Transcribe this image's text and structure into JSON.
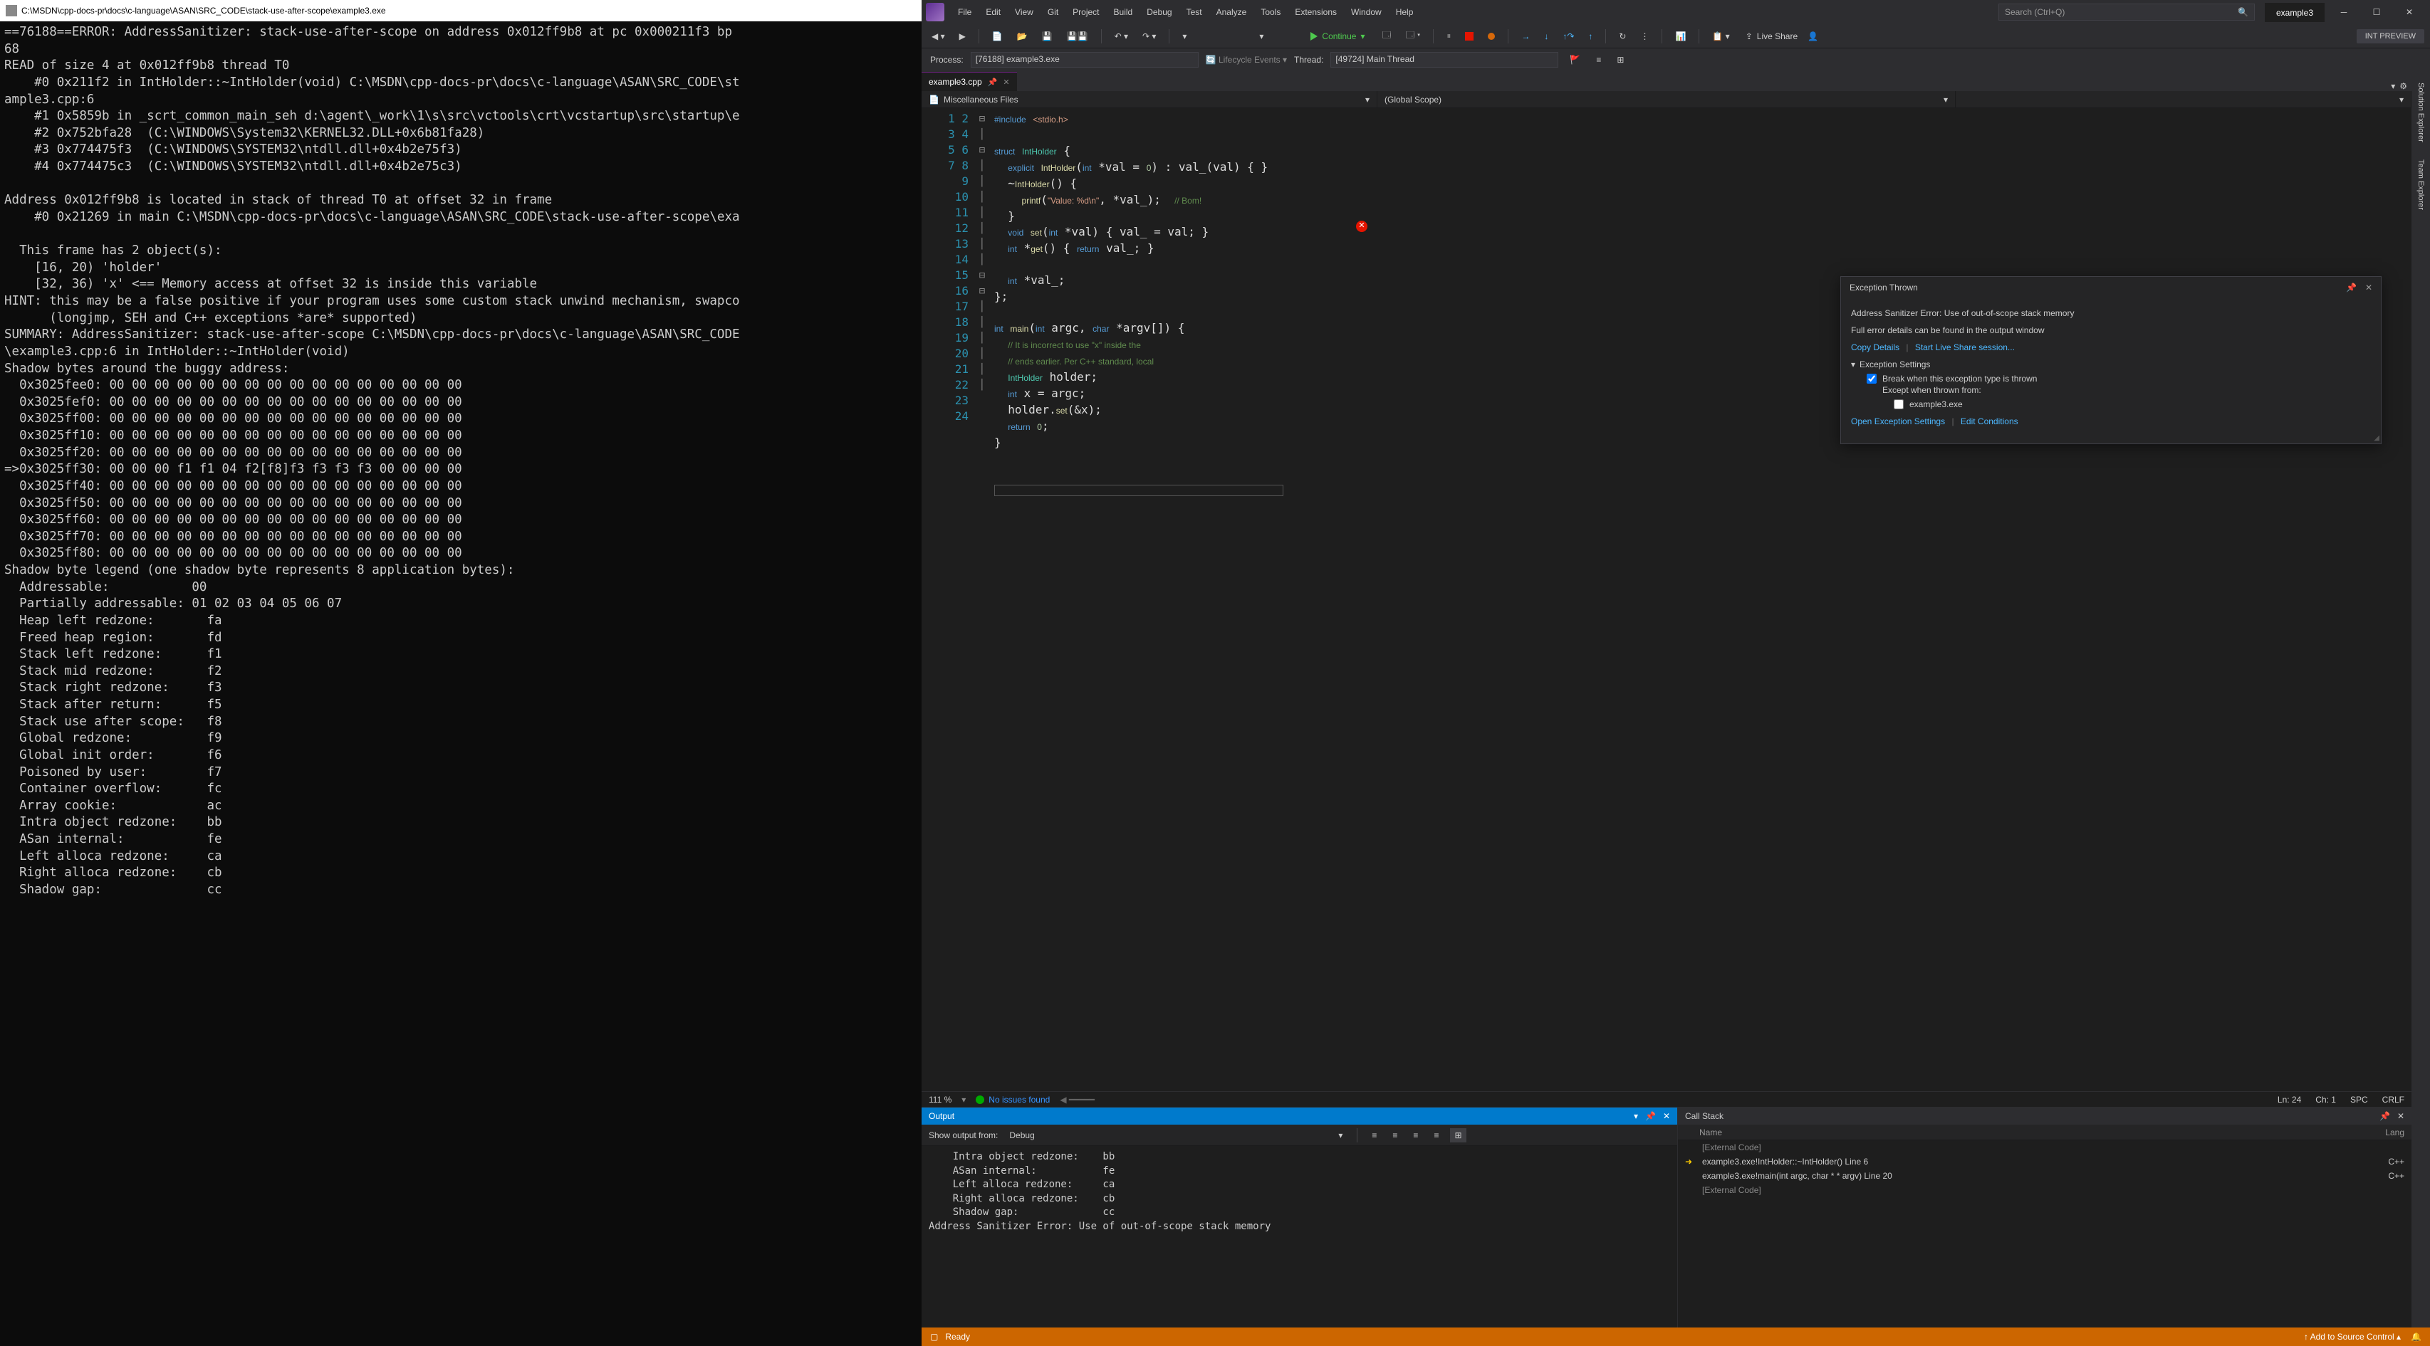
{
  "console": {
    "title": "C:\\MSDN\\cpp-docs-pr\\docs\\c-language\\ASAN\\SRC_CODE\\stack-use-after-scope\\example3.exe",
    "body": "==76188==ERROR: AddressSanitizer: stack-use-after-scope on address 0x012ff9b8 at pc 0x000211f3 bp\n68\nREAD of size 4 at 0x012ff9b8 thread T0\n    #0 0x211f2 in IntHolder::~IntHolder(void) C:\\MSDN\\cpp-docs-pr\\docs\\c-language\\ASAN\\SRC_CODE\\st\nample3.cpp:6\n    #1 0x5859b in _scrt_common_main_seh d:\\agent\\_work\\1\\s\\src\\vctools\\crt\\vcstartup\\src\\startup\\e\n    #2 0x752bfa28  (C:\\WINDOWS\\System32\\KERNEL32.DLL+0x6b81fa28)\n    #3 0x774475f3  (C:\\WINDOWS\\SYSTEM32\\ntdll.dll+0x4b2e75f3)\n    #4 0x774475c3  (C:\\WINDOWS\\SYSTEM32\\ntdll.dll+0x4b2e75c3)\n\nAddress 0x012ff9b8 is located in stack of thread T0 at offset 32 in frame\n    #0 0x21269 in main C:\\MSDN\\cpp-docs-pr\\docs\\c-language\\ASAN\\SRC_CODE\\stack-use-after-scope\\exa\n\n  This frame has 2 object(s):\n    [16, 20) 'holder'\n    [32, 36) 'x' <== Memory access at offset 32 is inside this variable\nHINT: this may be a false positive if your program uses some custom stack unwind mechanism, swapco\n      (longjmp, SEH and C++ exceptions *are* supported)\nSUMMARY: AddressSanitizer: stack-use-after-scope C:\\MSDN\\cpp-docs-pr\\docs\\c-language\\ASAN\\SRC_CODE\n\\example3.cpp:6 in IntHolder::~IntHolder(void)\nShadow bytes around the buggy address:\n  0x3025fee0: 00 00 00 00 00 00 00 00 00 00 00 00 00 00 00 00\n  0x3025fef0: 00 00 00 00 00 00 00 00 00 00 00 00 00 00 00 00\n  0x3025ff00: 00 00 00 00 00 00 00 00 00 00 00 00 00 00 00 00\n  0x3025ff10: 00 00 00 00 00 00 00 00 00 00 00 00 00 00 00 00\n  0x3025ff20: 00 00 00 00 00 00 00 00 00 00 00 00 00 00 00 00\n=>0x3025ff30: 00 00 00 f1 f1 04 f2[f8]f3 f3 f3 f3 00 00 00 00\n  0x3025ff40: 00 00 00 00 00 00 00 00 00 00 00 00 00 00 00 00\n  0x3025ff50: 00 00 00 00 00 00 00 00 00 00 00 00 00 00 00 00\n  0x3025ff60: 00 00 00 00 00 00 00 00 00 00 00 00 00 00 00 00\n  0x3025ff70: 00 00 00 00 00 00 00 00 00 00 00 00 00 00 00 00\n  0x3025ff80: 00 00 00 00 00 00 00 00 00 00 00 00 00 00 00 00\nShadow byte legend (one shadow byte represents 8 application bytes):\n  Addressable:           00\n  Partially addressable: 01 02 03 04 05 06 07\n  Heap left redzone:       fa\n  Freed heap region:       fd\n  Stack left redzone:      f1\n  Stack mid redzone:       f2\n  Stack right redzone:     f3\n  Stack after return:      f5\n  Stack use after scope:   f8\n  Global redzone:          f9\n  Global init order:       f6\n  Poisoned by user:        f7\n  Container overflow:      fc\n  Array cookie:            ac\n  Intra object redzone:    bb\n  ASan internal:           fe\n  Left alloca redzone:     ca\n  Right alloca redzone:    cb\n  Shadow gap:              cc"
  },
  "vs": {
    "menus": [
      "File",
      "Edit",
      "View",
      "Git",
      "Project",
      "Build",
      "Debug",
      "Test",
      "Analyze",
      "Tools",
      "Extensions",
      "Window",
      "Help"
    ],
    "search_placeholder": "Search (Ctrl+Q)",
    "solution_title": "example3",
    "intpreview": "INT PREVIEW",
    "liveshare": "Live Share",
    "continue": "Continue",
    "process_label": "Process:",
    "process_value": "[76188] example3.exe",
    "lifecycle": "Lifecycle Events",
    "thread_label": "Thread:",
    "thread_value": "[49724] Main Thread",
    "tabs": {
      "file": "example3.cpp"
    },
    "nav_left": "Miscellaneous Files",
    "nav_right": "(Global Scope)",
    "code_lines": 24,
    "status": {
      "zoom": "111 %",
      "issues": "No issues found",
      "ln": "Ln: 24",
      "ch": "Ch: 1",
      "spc": "SPC",
      "crlf": "CRLF"
    },
    "exception": {
      "title": "Exception Thrown",
      "msg": "Address Sanitizer Error: Use of out-of-scope stack memory",
      "details": "Full error details can be found in the output window",
      "copy": "Copy Details",
      "start_ls": "Start Live Share session...",
      "settings_hdr": "Exception Settings",
      "break_when": "Break when this exception type is thrown",
      "except_when": "Except when thrown from:",
      "except_item": "example3.exe",
      "open_settings": "Open Exception Settings",
      "edit_cond": "Edit Conditions"
    },
    "output": {
      "title": "Output",
      "show_label": "Show output from:",
      "show_value": "Debug",
      "body": "    Intra object redzone:    bb\n    ASan internal:           fe\n    Left alloca redzone:     ca\n    Right alloca redzone:    cb\n    Shadow gap:              cc\nAddress Sanitizer Error: Use of out-of-scope stack memory"
    },
    "callstack": {
      "title": "Call Stack",
      "col_name": "Name",
      "col_lang": "Lang",
      "rows": [
        {
          "name": "[External Code]",
          "lang": "",
          "ext": true,
          "arrow": false
        },
        {
          "name": "example3.exe!IntHolder::~IntHolder() Line 6",
          "lang": "C++",
          "ext": false,
          "arrow": true
        },
        {
          "name": "example3.exe!main(int argc, char * * argv) Line 20",
          "lang": "C++",
          "ext": false,
          "arrow": false
        },
        {
          "name": "[External Code]",
          "lang": "",
          "ext": true,
          "arrow": false
        }
      ]
    },
    "statusbar": {
      "ready": "Ready",
      "add_src": "Add to Source Control"
    },
    "side_tabs": [
      "Solution Explorer",
      "Team Explorer"
    ]
  }
}
